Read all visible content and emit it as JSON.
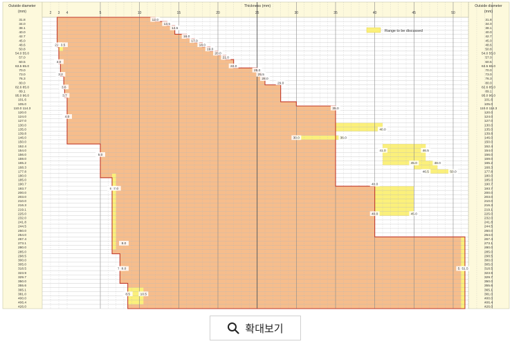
{
  "chart_data": {
    "type": "table",
    "title": "Thickness (mm)",
    "column_header_left": "Outside diameter",
    "column_header_left_unit": "(mm)",
    "column_header_right": "Outside diameter",
    "column_header_right_unit": "(mm)",
    "legend_label": "Range to be discussed",
    "x_ticks": [
      2,
      3,
      4,
      5,
      10,
      15,
      20,
      25,
      30,
      35,
      40,
      45,
      50
    ],
    "x_tick_labels": [
      "2",
      "3",
      "4",
      "5",
      "10",
      "15",
      "20",
      "25",
      "30",
      "35",
      "40",
      "45",
      "50"
    ],
    "diameters": [
      "31.8",
      "34.0",
      "38.1",
      "40.0",
      "42.7",
      "45.0",
      "48.6",
      "50.8",
      "54.0  55.0",
      "57.0",
      "60.5",
      "63.5  65.0",
      "70.0",
      "73.0",
      "76.3",
      "80.0",
      "82.6  85.0",
      "89.1",
      "95.0  96.0",
      "101.6",
      "105.0",
      "110.0  114.3",
      "120.0",
      "124.0",
      "127.0",
      "130.0",
      "135.0",
      "139.8",
      "146.0",
      "150.0",
      "152.4",
      "154.0",
      "156.0",
      "159.0",
      "165.2",
      "168.3",
      "177.8",
      "180.0",
      "185.0",
      "190.7",
      "193.7",
      "200.0",
      "203.0",
      "210.0",
      "216.3",
      "219.1",
      "225.0",
      "232.0",
      "241.8",
      "244.5",
      "250.0",
      "254.0",
      "267.4",
      "273.1",
      "280.0",
      "285.0",
      "298.5",
      "300.0",
      "305.0",
      "318.5",
      "323.9",
      "329.7",
      "350.0",
      "355.6",
      "365.1",
      "381.0",
      "400.0",
      "406.4",
      "426.0"
    ],
    "series": [
      {
        "name": "Manufacturable range",
        "min_thickness": [
          2.8,
          2.8,
          2.8,
          2.8,
          2.8,
          2.8,
          2.8,
          3.0,
          3.0,
          3.0,
          3.0,
          3.2,
          3.2,
          3.2,
          3.6,
          3.6,
          3.6,
          3.7,
          3.7,
          4.0,
          4.0,
          4.0,
          4.0,
          4.0,
          4.0,
          4.0,
          4.0,
          4.0,
          4.0,
          4.0,
          5.0,
          5.0,
          5.0,
          5.0,
          5.0,
          5.0,
          5.0,
          5.0,
          6.5,
          6.5,
          6.5,
          6.5,
          6.5,
          6.5,
          6.5,
          6.5,
          6.5,
          6.5,
          6.5,
          6.5,
          6.5,
          6.5,
          6.5,
          6.5,
          6.5,
          6.5,
          7.5,
          7.5,
          7.5,
          7.5,
          7.5,
          7.5,
          7.5,
          8.5,
          8.5,
          8.5,
          8.5,
          8.5,
          8.5
        ],
        "max_thickness": [
          12.0,
          13.5,
          14.5,
          14.5,
          16.0,
          17.0,
          18.0,
          19.0,
          20.0,
          21.0,
          22.0,
          22.0,
          25.0,
          25.5,
          26.0,
          26.0,
          28.0,
          28.0,
          28.0,
          28.0,
          30.0,
          35.0,
          35.0,
          35.0,
          35.0,
          35.0,
          35.0,
          35.0,
          35.0,
          35.0,
          35.0,
          35.0,
          35.0,
          35.0,
          35.0,
          35.0,
          35.0,
          35.0,
          35.0,
          35.0,
          40.0,
          40.0,
          40.0,
          40.0,
          40.0,
          40.0,
          40.0,
          40.0,
          40.0,
          40.0,
          40.0,
          40.0,
          51.5,
          51.5,
          51.5,
          51.5,
          51.5,
          51.5,
          51.5,
          51.5,
          51.5,
          51.5,
          51.5,
          51.5,
          51.5,
          51.5,
          51.5,
          51.5,
          51.5
        ]
      },
      {
        "name": "Range to be discussed",
        "bands": [
          {
            "from": "48.6",
            "to": "50.8",
            "thickness": [
              3.0,
              3.5
            ]
          },
          {
            "from": "130.0",
            "to": "135.0",
            "thickness": [
              35.0,
              41.0
            ]
          },
          {
            "from": "146.0",
            "to": "146.0",
            "thickness": [
              30.0,
              36.0
            ]
          },
          {
            "from": "152.4",
            "to": "165.2",
            "thickness": [
              41.0,
              46.5
            ]
          },
          {
            "from": "165.2",
            "to": "168.3",
            "thickness": [
              45.0,
              48.0
            ]
          },
          {
            "from": "177.8",
            "to": "177.8",
            "thickness": [
              46.5,
              50.0
            ]
          },
          {
            "from": "193.7",
            "to": "225.0",
            "thickness": [
              40.0,
              45.0
            ]
          },
          {
            "from": "180.0",
            "to": "280.0",
            "thickness": [
              6.5,
              7.0
            ]
          },
          {
            "from": "267.4",
            "to": "426.0",
            "thickness": [
              51.0,
              51.5
            ]
          },
          {
            "from": "365.1",
            "to": "406.4",
            "thickness": [
              8.5,
              10.5
            ]
          }
        ]
      }
    ],
    "annotations": [
      {
        "label": "12.0",
        "row": 0,
        "thickness": 12.0
      },
      {
        "label": "13.5",
        "row": 1,
        "thickness": 13.5
      },
      {
        "label": "14.5",
        "row": 2,
        "thickness": 14.5
      },
      {
        "label": "16.0",
        "row": 4,
        "thickness": 16.0
      },
      {
        "label": "17.0",
        "row": 5,
        "thickness": 17.0
      },
      {
        "label": "18.0",
        "row": 6,
        "thickness": 18.0
      },
      {
        "label": "19.0",
        "row": 7,
        "thickness": 19.0
      },
      {
        "label": "20.0",
        "row": 8,
        "thickness": 20.0
      },
      {
        "label": "21.0",
        "row": 9,
        "thickness": 21.0
      },
      {
        "label": "22.0",
        "row": 11,
        "thickness": 22.0
      },
      {
        "label": "25.0",
        "row": 12,
        "thickness": 25.0
      },
      {
        "label": "25.5",
        "row": 13,
        "thickness": 25.5
      },
      {
        "label": "28.0",
        "row": 14,
        "thickness": 26.0
      },
      {
        "label": "29.0",
        "row": 15,
        "thickness": 28.0
      },
      {
        "label": "35.0",
        "row": 21,
        "thickness": 35.0
      },
      {
        "label": "40.0",
        "row": 26,
        "thickness": 41.0
      },
      {
        "label": "30.0",
        "row": 28,
        "thickness": 30.0
      },
      {
        "label": "36.0",
        "row": 28,
        "thickness": 36.0
      },
      {
        "label": "41.0",
        "row": 31,
        "thickness": 41.0
      },
      {
        "label": "46.5",
        "row": 31,
        "thickness": 46.5
      },
      {
        "label": "45.0",
        "row": 34,
        "thickness": 45.0
      },
      {
        "label": "48.0",
        "row": 34,
        "thickness": 48.0
      },
      {
        "label": "46.5",
        "row": 36,
        "thickness": 46.5
      },
      {
        "label": "50.0",
        "row": 36,
        "thickness": 50.0
      },
      {
        "label": "40.0",
        "row": 39,
        "thickness": 40.0
      },
      {
        "label": "40.0",
        "row": 46,
        "thickness": 40.0
      },
      {
        "label": "45.0",
        "row": 46,
        "thickness": 45.0
      },
      {
        "label": "2.8",
        "row": 6,
        "thickness": 2.8
      },
      {
        "label": "3.5",
        "row": 6,
        "thickness": 3.5
      },
      {
        "label": "3.0",
        "row": 10,
        "thickness": 3.0
      },
      {
        "label": "3.2",
        "row": 13,
        "thickness": 3.2
      },
      {
        "label": "3.6",
        "row": 16,
        "thickness": 3.6
      },
      {
        "label": "3.7",
        "row": 18,
        "thickness": 3.7
      },
      {
        "label": "4.0",
        "row": 23,
        "thickness": 4.0
      },
      {
        "label": "5.0",
        "row": 32,
        "thickness": 5.0
      },
      {
        "label": "6.5",
        "row": 40,
        "thickness": 6.5
      },
      {
        "label": "7.0",
        "row": 40,
        "thickness": 7.0
      },
      {
        "label": "8.0",
        "row": 53,
        "thickness": 8.0
      },
      {
        "label": "7.5",
        "row": 59,
        "thickness": 7.5
      },
      {
        "label": "8.0",
        "row": 59,
        "thickness": 8.0
      },
      {
        "label": "8.5",
        "row": 65,
        "thickness": 8.5
      },
      {
        "label": "10.5",
        "row": 65,
        "thickness": 10.5
      },
      {
        "label": "51.0",
        "row": 59,
        "thickness": 51.0
      },
      {
        "label": "51.5",
        "row": 59,
        "thickness": 51.5
      }
    ],
    "colors": {
      "fill": "#f6bd8c",
      "yellow": "#fbf07b",
      "outline": "#c0392b",
      "header_bg": "#fdf9dc",
      "grid": "#b9b9b9"
    }
  },
  "zoom_button": {
    "label": "확대보기",
    "icon": "magnifier-icon"
  }
}
